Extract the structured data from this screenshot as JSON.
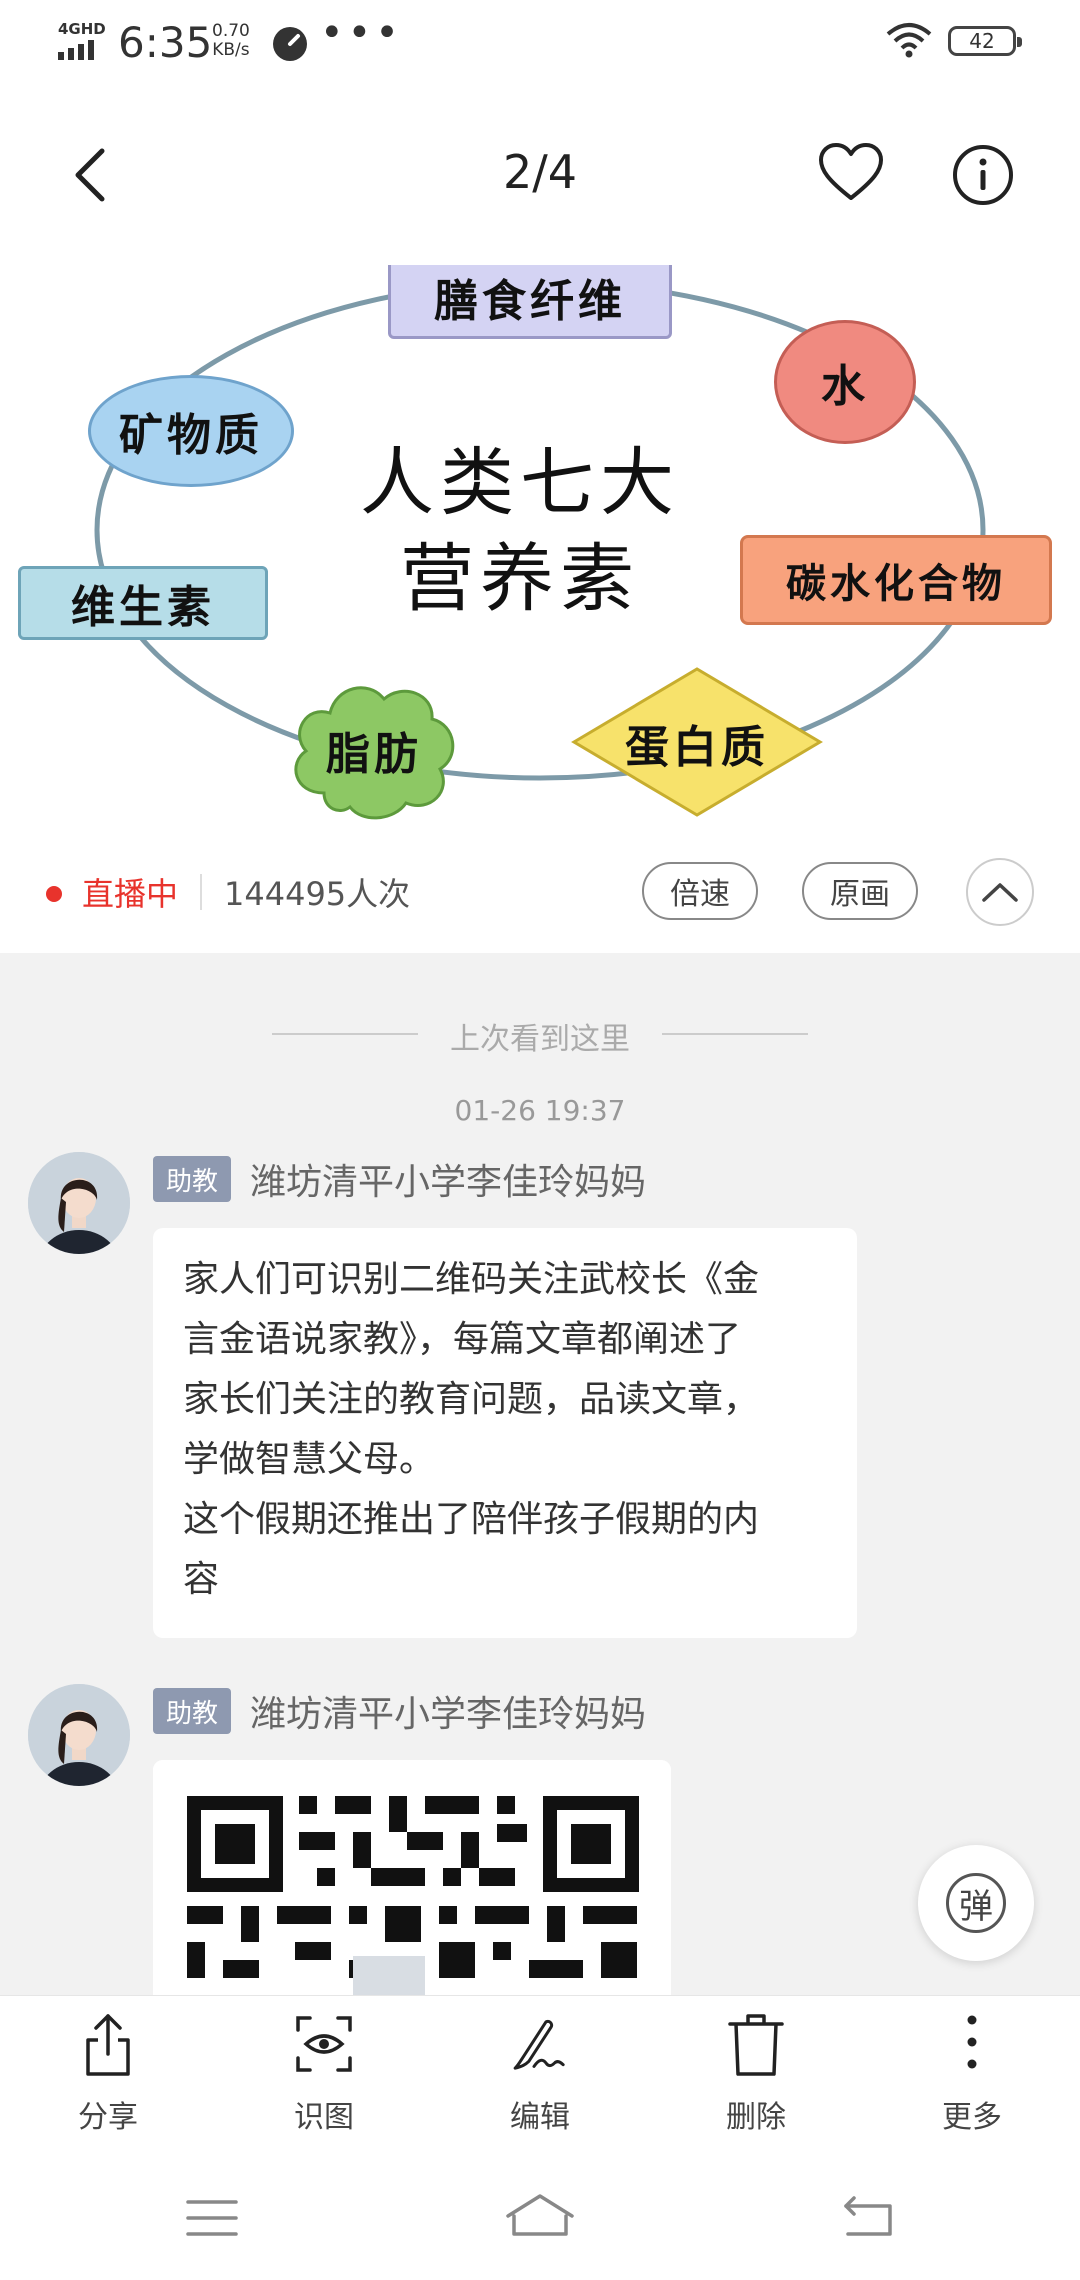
{
  "status_bar": {
    "network": "4GHD",
    "time": "6:35",
    "speed_value": "0.70",
    "speed_unit": "KB/s",
    "more_dots": "•••",
    "battery": "42"
  },
  "header": {
    "counter": "2/4"
  },
  "image": {
    "center_line1": "人类七大",
    "center_line2": "营养素",
    "nodes": {
      "fiber": "膳食纤维",
      "water": "水",
      "minerals": "矿物质",
      "vitamins": "维生素",
      "carbs": "碳水化合物",
      "fat": "脂肪",
      "protein": "蛋白质"
    }
  },
  "live": {
    "status": "直播中",
    "views": "144495人次",
    "speed_button": "倍速",
    "original_button": "原画"
  },
  "chat": {
    "seen_marker": "上次看到这里",
    "timestamp": "01-26 19:37",
    "messages": [
      {
        "badge": "助教",
        "sender": "潍坊清平小学李佳玲妈妈",
        "text_line1": "家人们可识别二维码关注武校长《金",
        "text_line2": "言金语说家教》，每篇文章都阐述了",
        "text_line3": "家长们关注的教育问题，品读文章，",
        "text_line4": "学做智慧父母。",
        "text_line5": "这个假期还推出了陪伴孩子假期的内",
        "text_line6": "容"
      },
      {
        "badge": "助教",
        "sender": "潍坊清平小学李佳玲妈妈"
      }
    ],
    "danmaku_button": "弹"
  },
  "toolbar": {
    "share": "分享",
    "recognize": "识图",
    "edit": "编辑",
    "delete": "删除",
    "more": "更多"
  },
  "colors": {
    "live_red": "#e8332c",
    "badge_bg": "#8e99b0",
    "fiber": "#d4d3f3",
    "water": "#f08a80",
    "minerals": "#a9d3f1",
    "vitamins": "#b6dde8",
    "carbs": "#f8a27d",
    "fat": "#8dc864",
    "protein": "#f7e26b"
  }
}
